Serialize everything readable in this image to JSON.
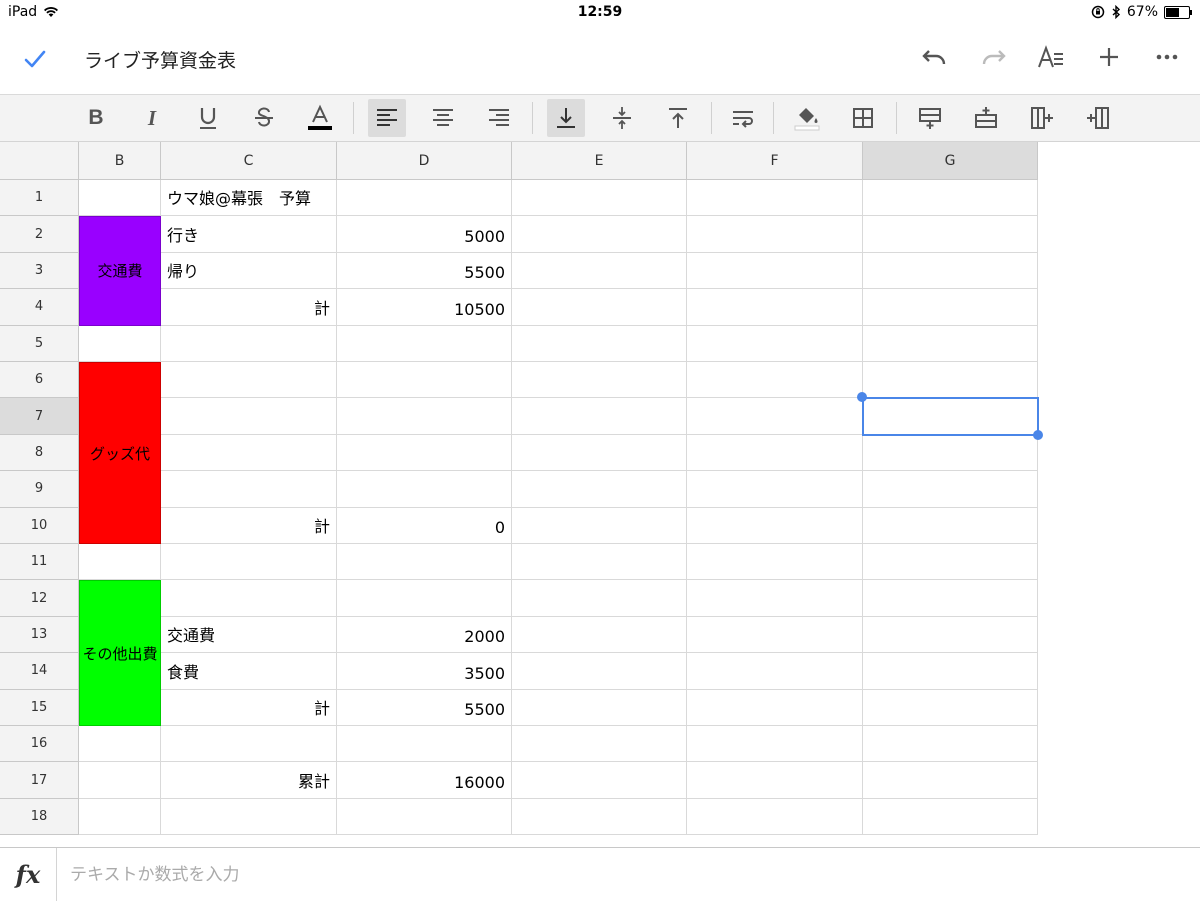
{
  "status_bar": {
    "device": "iPad",
    "time": "12:59",
    "battery_percent": "67%",
    "battery_level": 0.67
  },
  "header": {
    "title": "ライブ予算資金表"
  },
  "accent_color": "#4285f4",
  "toolbar_icons": [
    "bold-icon",
    "italic-icon",
    "underline-icon",
    "strikethrough-icon",
    "text-color-icon",
    "align-left-icon",
    "align-center-icon",
    "align-right-icon",
    "valign-bottom-icon",
    "valign-middle-icon",
    "valign-top-icon",
    "wrap-text-icon",
    "fill-color-icon",
    "borders-icon",
    "insert-row-above-icon",
    "insert-row-below-icon",
    "insert-column-left-icon",
    "insert-column-right-icon"
  ],
  "columns": [
    "",
    "B",
    "C",
    "D",
    "E",
    "F",
    "G"
  ],
  "rows": [
    "1",
    "2",
    "3",
    "4",
    "5",
    "6",
    "7",
    "8",
    "9",
    "10",
    "11",
    "12",
    "13",
    "14",
    "15",
    "16",
    "17",
    "18"
  ],
  "selected_cell": "G7",
  "cells": {
    "C1": "ウマ娘@幕張　予算",
    "C2": "行き",
    "D2": "5000",
    "C3": "帰り",
    "D3": "5500",
    "C4": "計",
    "D4": "10500",
    "C10": "計",
    "D10": "0",
    "C13": "交通費",
    "D13": "2000",
    "C14": "食費",
    "D14": "3500",
    "C15": "計",
    "D15": "5500",
    "C17": "累計",
    "D17": "16000"
  },
  "merged_blocks": [
    {
      "label": "交通費",
      "range": "B2:B4",
      "color": "#9900ff"
    },
    {
      "label": "グッズ代",
      "range": "B6:B10",
      "color": "#ff0000"
    },
    {
      "label": "その他出費",
      "range": "B12:B15",
      "color": "#00ff00"
    }
  ],
  "formula_bar": {
    "placeholder": "テキストか数式を入力",
    "value": ""
  }
}
